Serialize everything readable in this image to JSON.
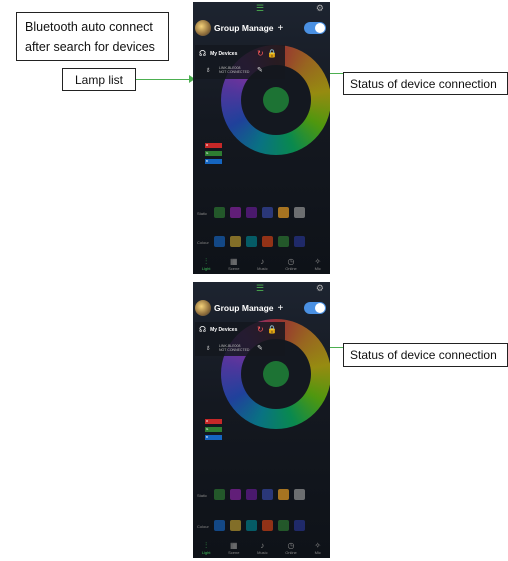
{
  "callouts": {
    "bluetooth": {
      "line1": "Bluetooth auto connect",
      "line2": "after search for devices"
    },
    "lamp_list": "Lamp list",
    "status_top": "Status of device connection",
    "status_bottom": "Status of device connection"
  },
  "app": {
    "group_manage": "Group Manage",
    "add_symbol": "+",
    "my_devices": "My Devices",
    "lamp": {
      "name": "LINK-BLE008",
      "sub": "NOT CONNECTED"
    },
    "legend": [
      "R",
      "G",
      "B"
    ],
    "rows": [
      "Static",
      "Colour"
    ],
    "tabs": [
      {
        "icon": "sliders-icon",
        "label": "Light"
      },
      {
        "icon": "grid-icon",
        "label": "Scene"
      },
      {
        "icon": "music-icon",
        "label": "Music"
      },
      {
        "icon": "timer-icon",
        "label": "Online"
      },
      {
        "icon": "mic-icon",
        "label": "Mic"
      }
    ]
  },
  "colors": {
    "accent_green": "#4caf50",
    "toggle_blue": "#4a90e2",
    "swatches_row1": [
      "#2e7d32",
      "#8e24aa",
      "#6a1b9a",
      "#3949ab",
      "#f9a825",
      "#9e9e9e"
    ],
    "swatches_row2": [
      "#1565c0",
      "#c0a030",
      "#00838f",
      "#d84315",
      "#2e7d32",
      "#283593"
    ]
  }
}
